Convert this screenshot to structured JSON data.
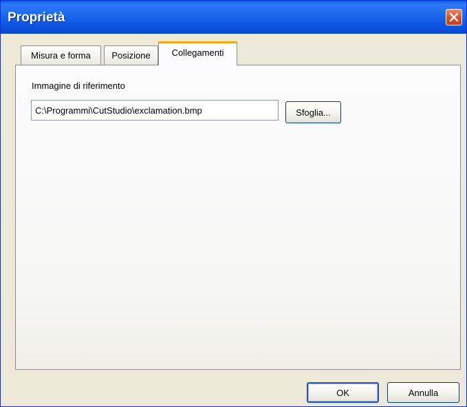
{
  "dialog": {
    "title": "Proprietà",
    "close_icon": "close-icon"
  },
  "tabs": [
    {
      "label": "Misura e forma",
      "active": false
    },
    {
      "label": "Posizione",
      "active": false
    },
    {
      "label": "Collegamenti",
      "active": true
    }
  ],
  "link_tab": {
    "field_label": "Immagine di riferimento",
    "path_value": "C:\\Programmi\\CutStudio\\exclamation.bmp",
    "browse_label": "Sfoglia..."
  },
  "buttons": {
    "ok_label": "OK",
    "cancel_label": "Annulla"
  },
  "colors": {
    "titlebar": "#0a5fe6",
    "active_tab_accent": "#f5a623",
    "close_button": "#d9532c"
  }
}
